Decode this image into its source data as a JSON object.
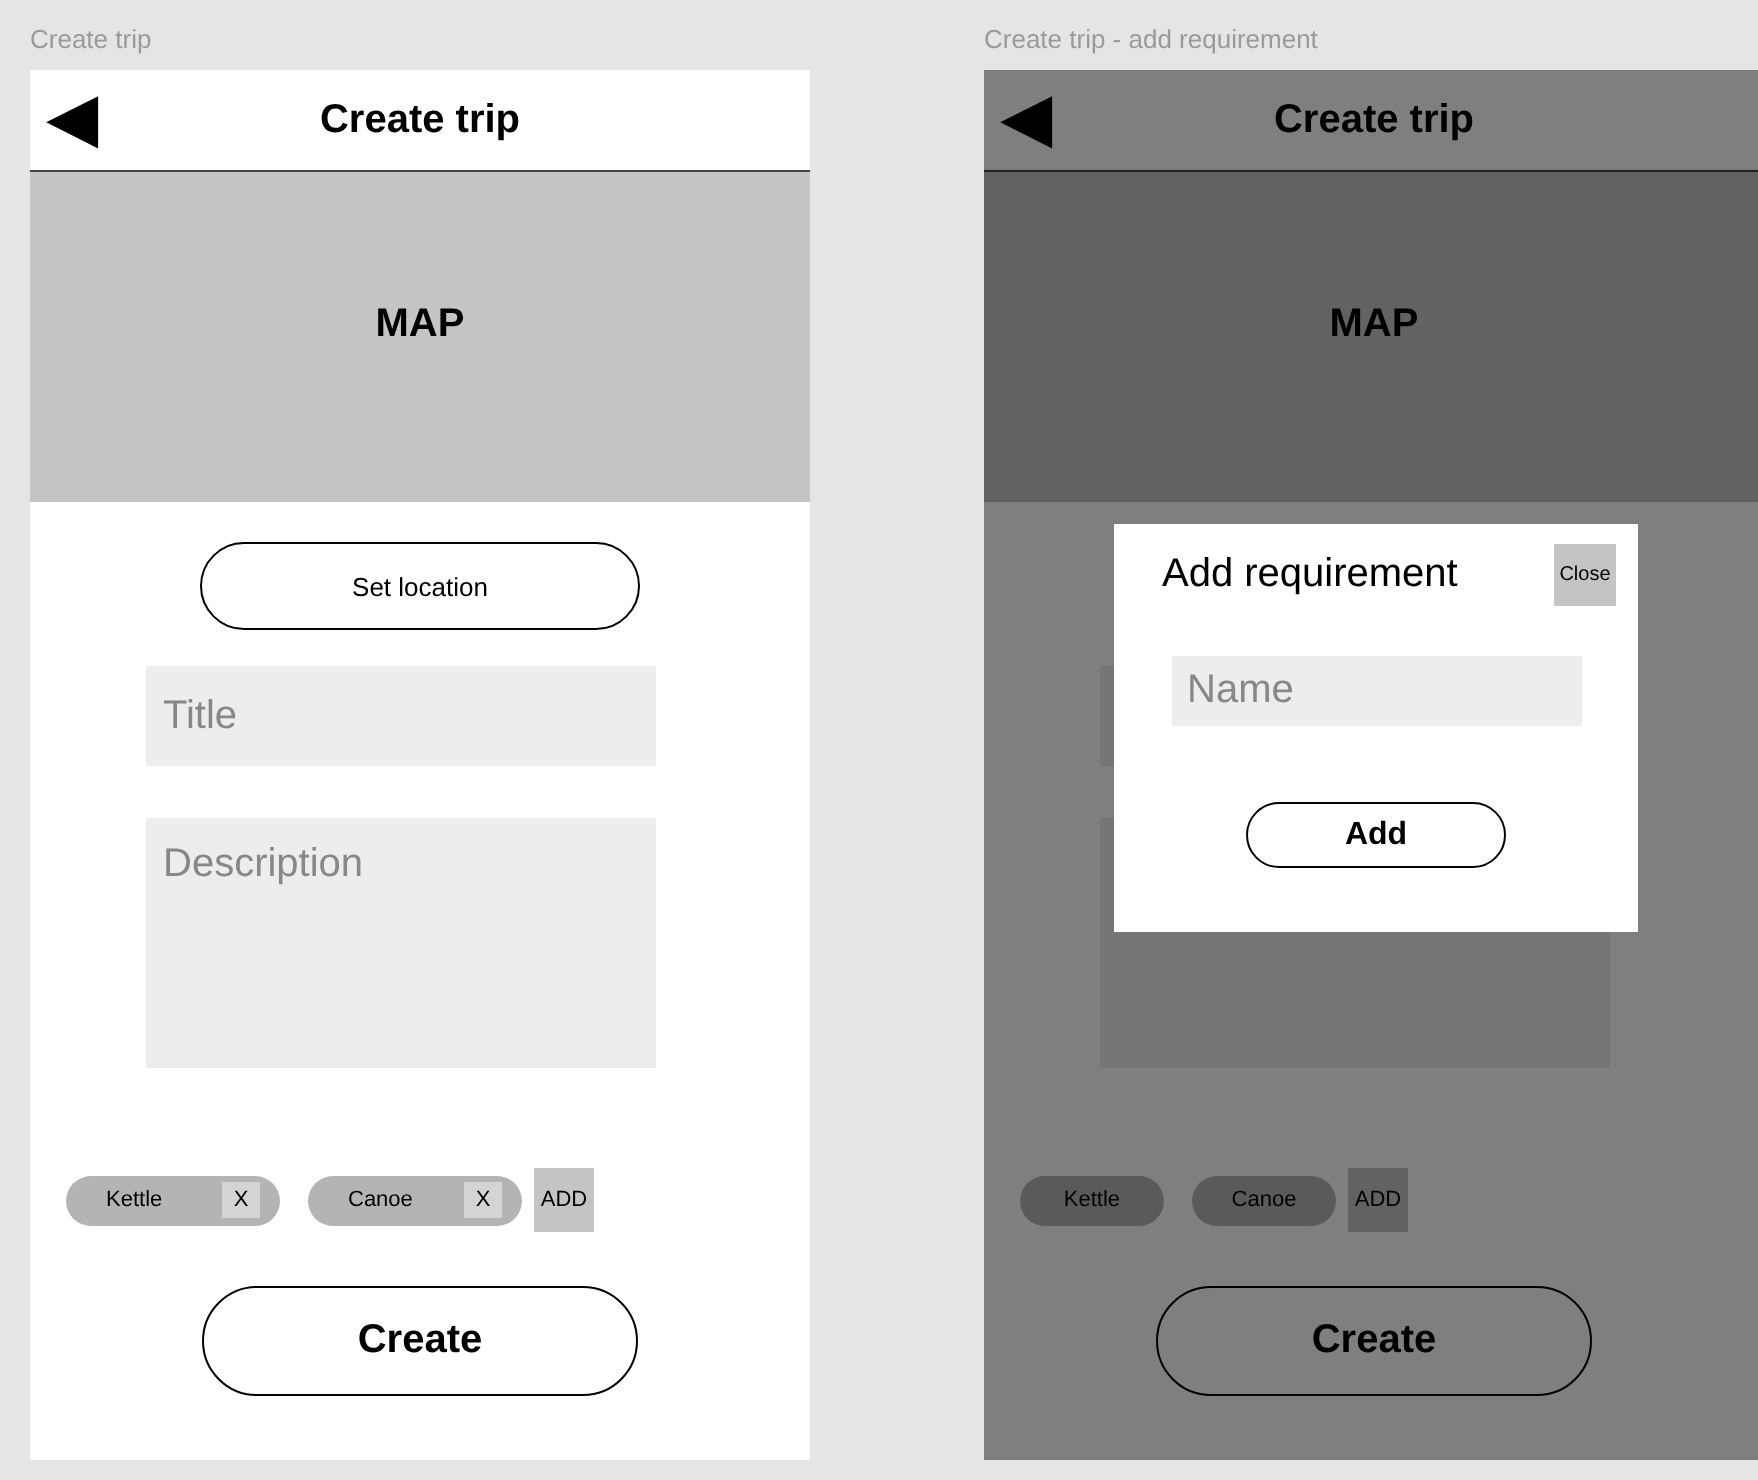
{
  "frames": [
    {
      "label": "Create trip",
      "dimmed": false,
      "header": {
        "back": "◀",
        "title": "Create trip"
      },
      "map": "MAP",
      "set_location": "Set location",
      "fields": [
        {
          "kind": "line",
          "placeholder": "Title"
        },
        {
          "kind": "area",
          "placeholder": "Description"
        }
      ],
      "chips": [
        {
          "label": "Kettle",
          "remove": "X"
        },
        {
          "label": "Canoe",
          "remove": "X"
        }
      ],
      "add": "ADD",
      "create": "Create"
    },
    {
      "label": "Create trip - add requirement",
      "dimmed": true,
      "header": {
        "back": "◀",
        "title": "Create trip"
      },
      "map": "MAP",
      "fields": [
        {
          "kind": "line"
        },
        {
          "kind": "area"
        }
      ],
      "chips": [
        {
          "label": "Kettle"
        },
        {
          "label": "Canoe"
        }
      ],
      "add": "ADD",
      "create": "Create",
      "dialog": {
        "title": "Add requirement",
        "close": "Close",
        "placeholder": "Name",
        "add": "Add"
      }
    }
  ]
}
